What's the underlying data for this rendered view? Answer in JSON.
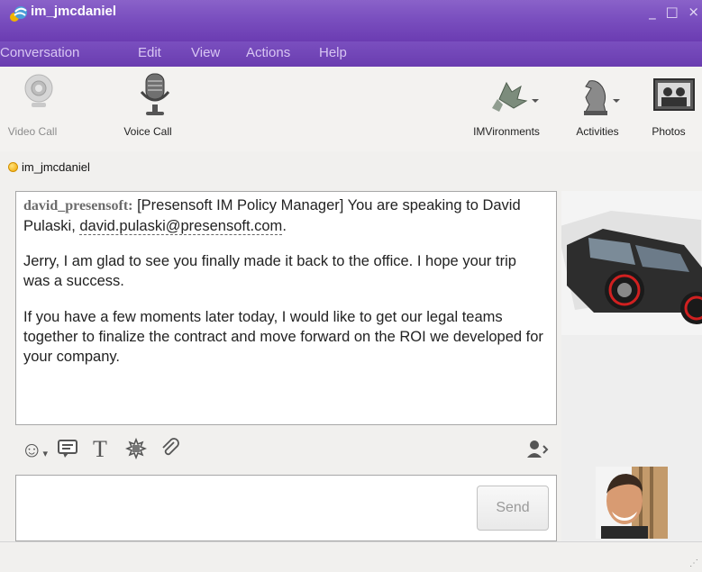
{
  "window": {
    "title": "im_jmcdaniel",
    "controls": [
      "minimize",
      "maximize",
      "close"
    ]
  },
  "menu": [
    "Conversation",
    "Edit",
    "View",
    "Actions",
    "Help"
  ],
  "toolbar": {
    "left": [
      {
        "label": "Video Call",
        "icon": "webcam-icon"
      },
      {
        "label": "Voice Call",
        "icon": "microphone-icon"
      }
    ],
    "right": [
      {
        "label": "IMVironments",
        "icon": "imvironments-icon"
      },
      {
        "label": "Activities",
        "icon": "chess-knight-icon"
      },
      {
        "label": "Photos",
        "icon": "photos-icon"
      }
    ]
  },
  "contact": {
    "name": "im_jmcdaniel",
    "status_color": "#f0a500"
  },
  "conversation": {
    "sender": "david_presensoft:",
    "line1": " [Presensoft IM Policy Manager] You are speaking to David Pulaski, ",
    "email": "david.pulaski@presensoft.com",
    "line1_end": ".",
    "message2": "Jerry, I am glad to see you finally made it back to the office.  I hope your trip was a success.",
    "message3": "If you have a few moments later today, I would like to get our legal teams together to finalize the contract and move forward on the ROI we developed for your company."
  },
  "composer": {
    "value": "",
    "send_label": "Send"
  },
  "format_icons": [
    "emoticon-icon",
    "audible-icon",
    "text-format-icon",
    "nudge-icon",
    "attach-icon",
    "contact-details-icon"
  ],
  "colors": {
    "titlebar": "#7a4fbf",
    "accent_text": "#d8c6f3"
  }
}
